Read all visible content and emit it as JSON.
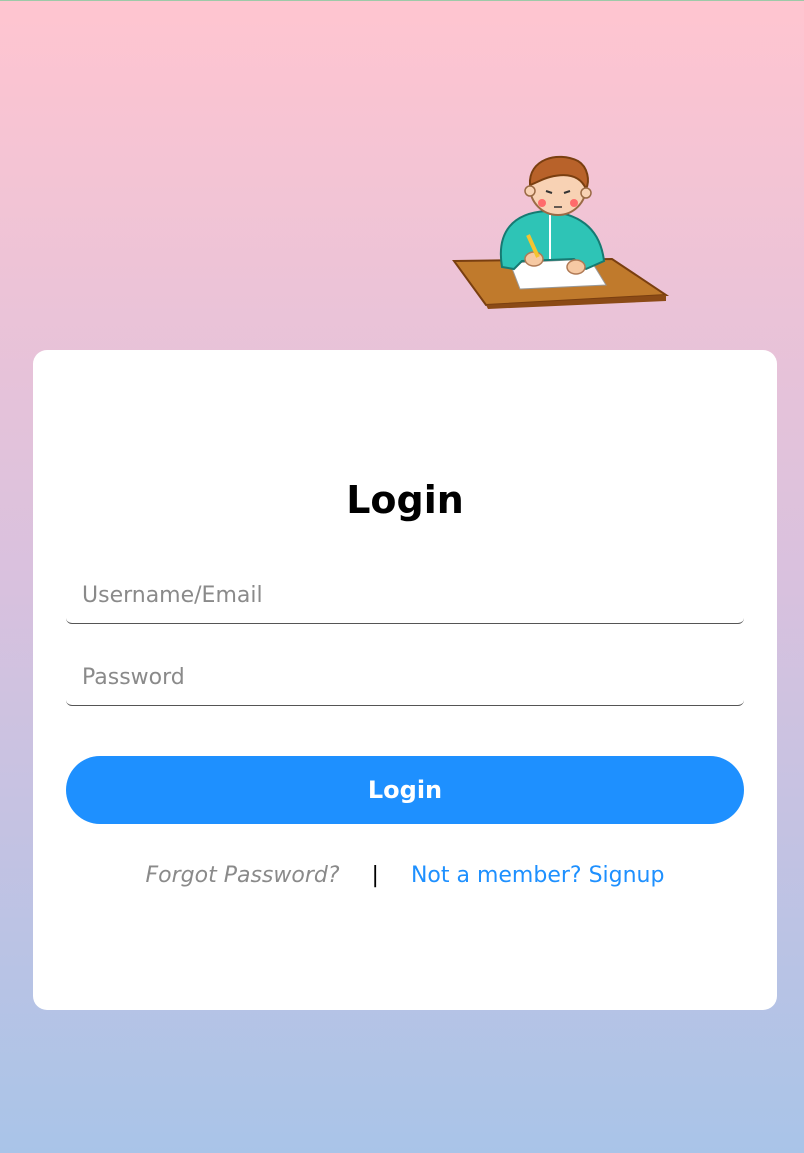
{
  "illustration": {
    "icon": "student-writing-illustration"
  },
  "login_form": {
    "title": "Login",
    "username_placeholder": "Username/Email",
    "password_placeholder": "Password",
    "submit_label": "Login",
    "forgot_label": "Forgot Password?",
    "separator": "|",
    "signup_label": "Not a member? Signup"
  },
  "colors": {
    "accent": "#1e90ff",
    "background_top": "#ffc5d0",
    "background_bottom": "#a9c4e8",
    "card": "#ffffff"
  }
}
